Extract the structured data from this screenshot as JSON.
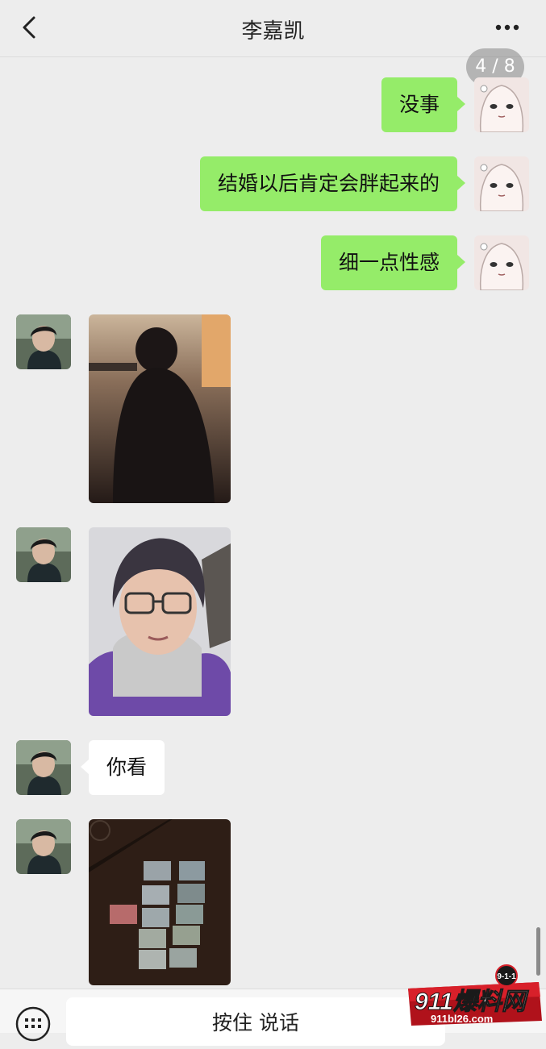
{
  "header": {
    "title": "李嘉凯"
  },
  "page_indicator": "4 / 8",
  "messages": [
    {
      "side": "right",
      "type": "text",
      "text": "没事"
    },
    {
      "side": "right",
      "type": "text",
      "text": "结婚以后肯定会胖起来的"
    },
    {
      "side": "right",
      "type": "text",
      "text": "细一点性感"
    },
    {
      "side": "left",
      "type": "image",
      "icon": "photo-silhouette"
    },
    {
      "side": "left",
      "type": "image",
      "icon": "photo-selfie"
    },
    {
      "side": "left",
      "type": "text",
      "text": "你看"
    },
    {
      "side": "left",
      "type": "image",
      "icon": "photo-cards"
    }
  ],
  "input": {
    "voice_label": "按住 说话"
  },
  "watermark": {
    "main": "911爆料网",
    "domain": "911bl26.com",
    "badge": "9-1-1"
  }
}
